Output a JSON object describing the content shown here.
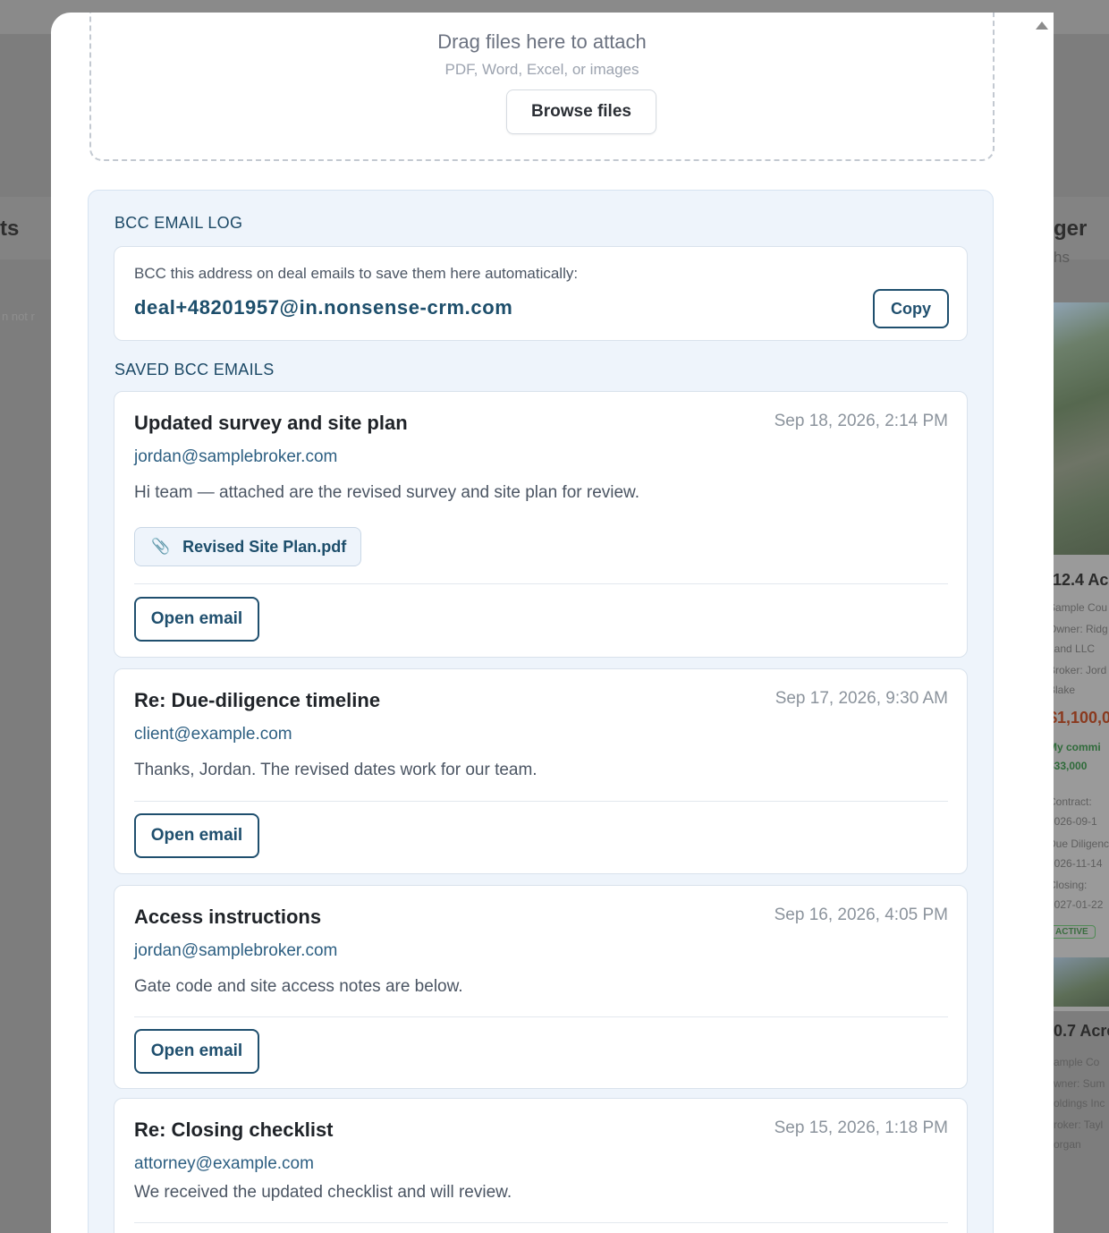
{
  "background": {
    "left_heading_fragment": "ts",
    "left_faint_fragment": "n not r",
    "right_heading_fragment": "ger",
    "right_sub_fragment": "hs",
    "cards": [
      {
        "title": "12.4 Acr",
        "lines": [
          "Sample Cou",
          "Owner: Ridg",
          "Land LLC",
          "Broker: Jord",
          "Blake"
        ],
        "price": "$1,100,00",
        "commission_label": "My commi",
        "commission_value": "$33,000",
        "dates": [
          "Contract:",
          "2026-09-1",
          "Due Diligenc",
          "2026-11-14",
          "Closing:",
          "2027-01-22"
        ],
        "status": "ACTIVE"
      },
      {
        "title": "0.7 Acre",
        "lines": [
          "ample Co",
          "wner: Sum",
          "oldings Inc",
          "roker: Tayl",
          "organ"
        ]
      }
    ]
  },
  "modal": {
    "dropzone": {
      "title": "Drag files here to attach",
      "subtitle": "PDF, Word, Excel, or images",
      "browse_label": "Browse files"
    },
    "bcc_log": {
      "heading": "BCC EMAIL LOG",
      "hint": "BCC this address on deal emails to save them here automatically:",
      "address": "deal+48201957@in.nonsense-crm.com",
      "copy_label": "Copy",
      "saved_heading": "SAVED BCC EMAILS",
      "emails": [
        {
          "subject": "Updated survey and site plan",
          "date": "Sep 18, 2026, 2:14 PM",
          "from": "jordan@samplebroker.com",
          "body": "Hi team — attached are the revised survey and site plan for review.",
          "attachment": "Revised Site Plan.pdf",
          "open_label": "Open email"
        },
        {
          "subject": "Re: Due-diligence timeline",
          "date": "Sep 17, 2026, 9:30 AM",
          "from": "client@example.com",
          "body": "Thanks, Jordan. The revised dates work for our team.",
          "open_label": "Open email"
        },
        {
          "subject": "Access instructions",
          "date": "Sep 16, 2026, 4:05 PM",
          "from": "jordan@samplebroker.com",
          "body": "Gate code and site access notes are below.",
          "open_label": "Open email"
        },
        {
          "subject": "Re: Closing checklist",
          "date": "Sep 15, 2026, 1:18 PM",
          "from": "attorney@example.com",
          "body": "We received the updated checklist and will review."
        }
      ]
    }
  }
}
